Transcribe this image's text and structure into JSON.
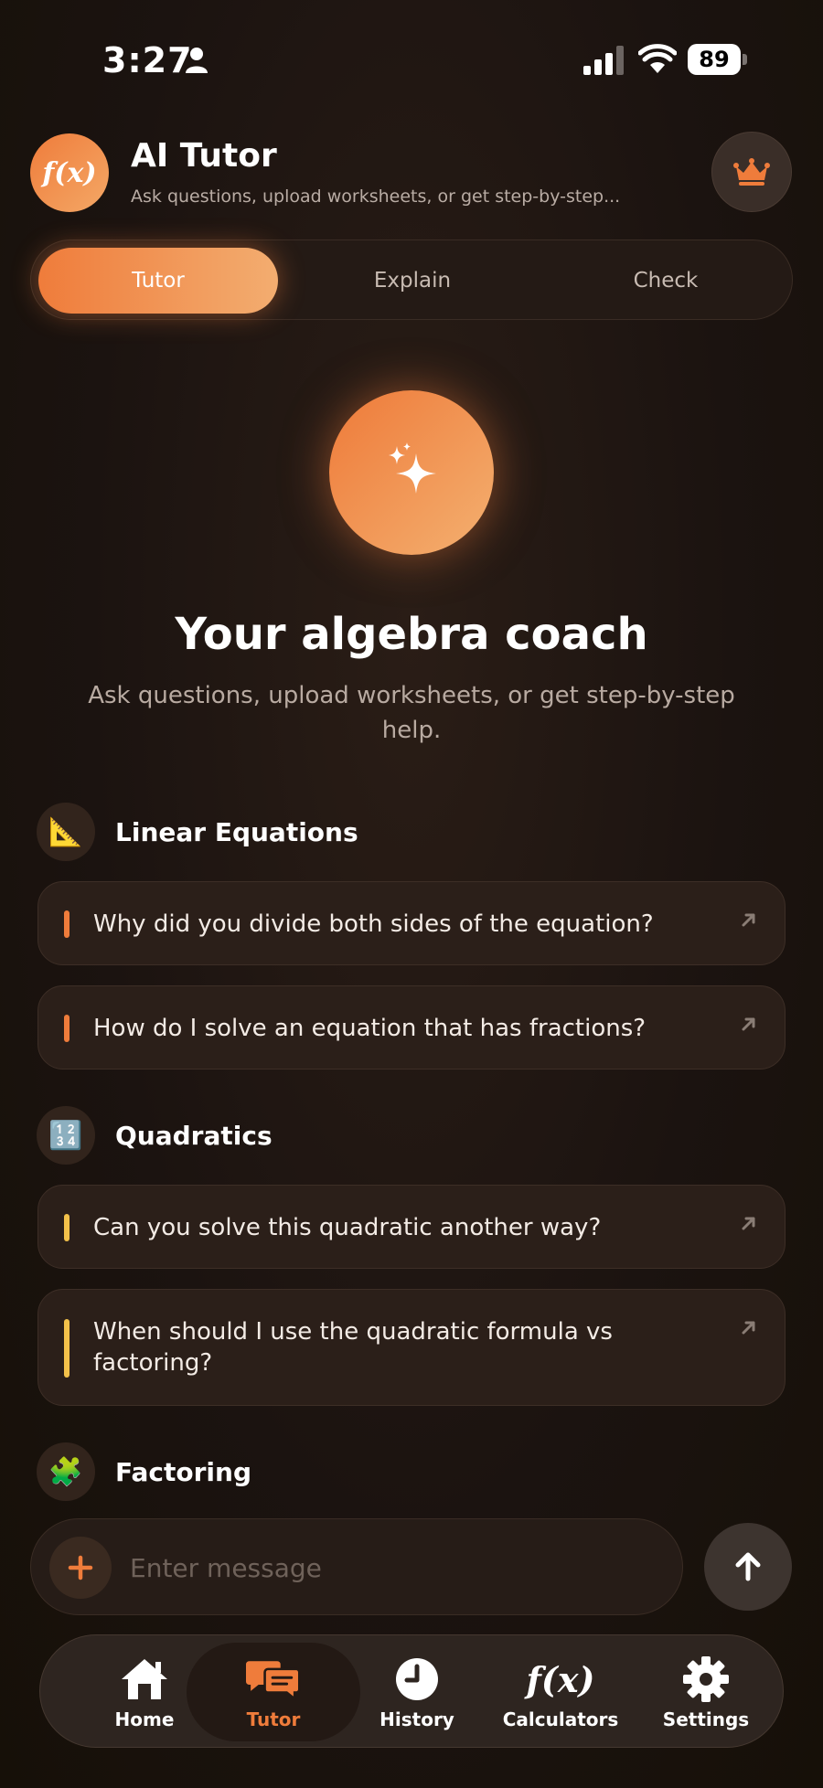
{
  "status_bar": {
    "time": "3:27",
    "battery": "89"
  },
  "header": {
    "logo_text": "f(x)",
    "title": "AI Tutor",
    "subtitle": "Ask questions, upload worksheets, or get step-by-step..."
  },
  "tabs": [
    {
      "label": "Tutor",
      "active": true
    },
    {
      "label": "Explain",
      "active": false
    },
    {
      "label": "Check",
      "active": false
    }
  ],
  "hero": {
    "title": "Your algebra coach",
    "subtitle": "Ask questions, upload worksheets, or get step-by-step help."
  },
  "sections": [
    {
      "title": "Linear Equations",
      "icon": "📐",
      "accent": "#ef7c3b",
      "suggestions": [
        "Why did you divide both sides of the equation?",
        "How do I solve an equation that has fractions?"
      ]
    },
    {
      "title": "Quadratics",
      "icon": "🔢",
      "accent": "#f3c14a",
      "suggestions": [
        "Can you solve this quadratic another way?",
        "When should I use the quadratic formula vs factoring?"
      ]
    },
    {
      "title": "Factoring",
      "icon": "🧩",
      "accent": "#7cc47a",
      "suggestions": []
    }
  ],
  "composer": {
    "placeholder": "Enter message"
  },
  "nav": [
    {
      "label": "Home",
      "icon": "home-icon",
      "active": false
    },
    {
      "label": "Tutor",
      "icon": "chat-icon",
      "active": true
    },
    {
      "label": "History",
      "icon": "clock-icon",
      "active": false
    },
    {
      "label": "Calculators",
      "icon": "fx-icon",
      "active": false,
      "icon_text": "f(x)"
    },
    {
      "label": "Settings",
      "icon": "gear-icon",
      "active": false
    }
  ],
  "colors": {
    "accent": "#ef7c3b",
    "background": "#1b1310"
  }
}
